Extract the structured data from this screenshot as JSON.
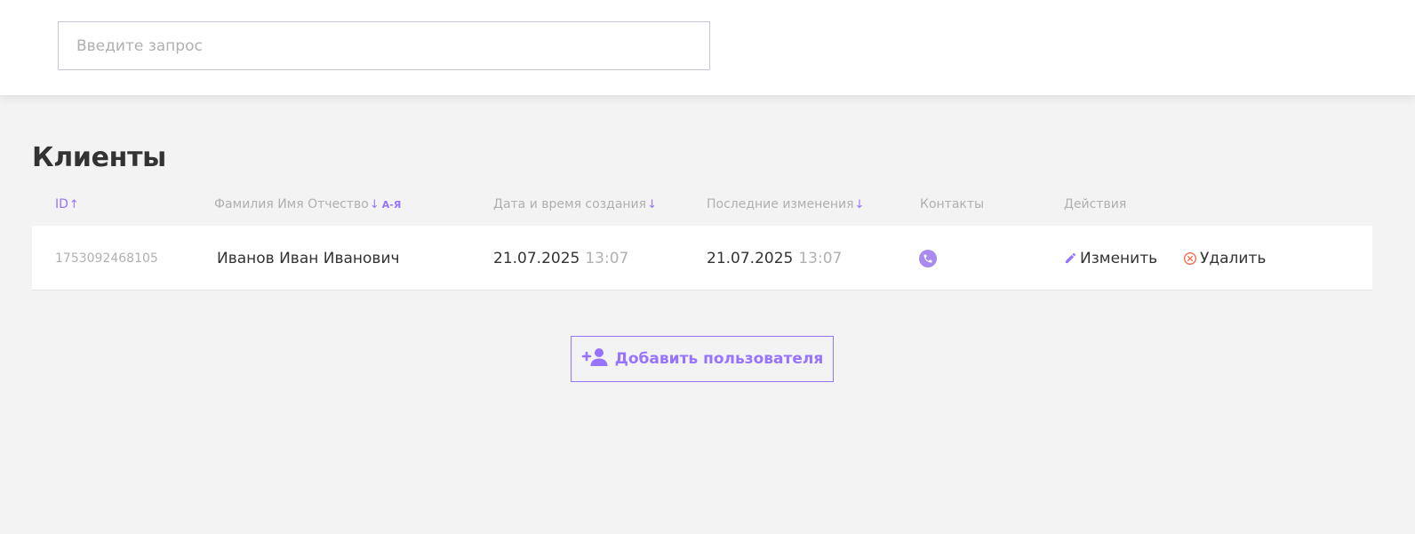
{
  "search": {
    "placeholder": "Введите запрос",
    "value": ""
  },
  "page": {
    "title": "Клиенты"
  },
  "table": {
    "columns": [
      {
        "label": "ID",
        "sort": "↑",
        "active": true
      },
      {
        "label": "Фамилия Имя Отчество",
        "sort": "↓",
        "badge": "А-Я"
      },
      {
        "label": "Дата и время создания",
        "sort": "↓"
      },
      {
        "label": "Последние изменения",
        "sort": "↓"
      },
      {
        "label": "Контакты"
      },
      {
        "label": "Действия"
      }
    ],
    "rows": [
      {
        "id": "1753092468105",
        "full_name": "Иванов Иван Иванович",
        "created_date": "21.07.2025",
        "created_time": "13:07",
        "updated_date": "21.07.2025",
        "updated_time": "13:07",
        "contacts": [
          "phone-icon"
        ],
        "edit_label": "Изменить",
        "delete_label": "Удалить"
      }
    ]
  },
  "add_button": {
    "label": "Добавить пользователя",
    "icon": "add-user-icon"
  },
  "colors": {
    "accent": "#9873ff",
    "delete": "#f06a4d",
    "muted": "#b0b0b0",
    "text": "#333333",
    "background": "#f3f3f3"
  }
}
